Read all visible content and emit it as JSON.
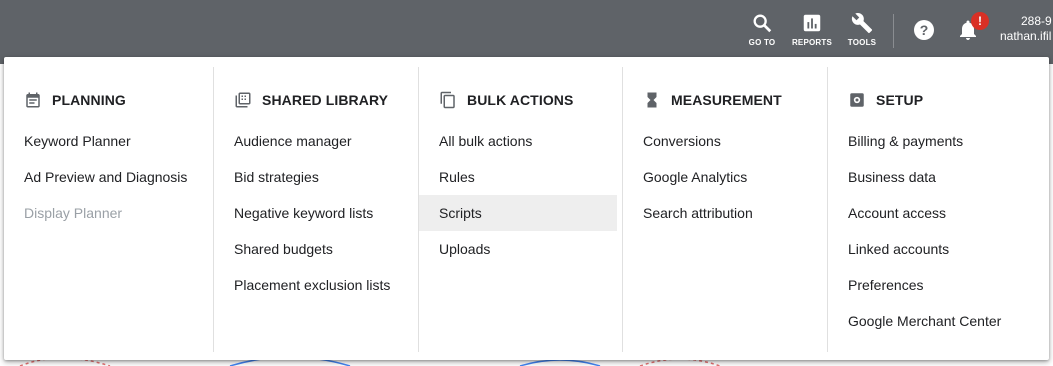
{
  "topbar": {
    "goto_label": "GO TO",
    "reports_label": "REPORTS",
    "tools_label": "TOOLS",
    "notification_badge": "!",
    "account_id": "288-9",
    "account_email": "nathan.ifil"
  },
  "menu": {
    "columns": [
      {
        "heading": "PLANNING",
        "icon": "calendar-icon",
        "items": [
          {
            "label": "Keyword Planner"
          },
          {
            "label": "Ad Preview and Diagnosis"
          },
          {
            "label": "Display Planner",
            "disabled": true
          }
        ]
      },
      {
        "heading": "SHARED LIBRARY",
        "icon": "library-icon",
        "items": [
          {
            "label": "Audience manager"
          },
          {
            "label": "Bid strategies"
          },
          {
            "label": "Negative keyword lists"
          },
          {
            "label": "Shared budgets"
          },
          {
            "label": "Placement exclusion lists"
          }
        ]
      },
      {
        "heading": "BULK ACTIONS",
        "icon": "copy-icon",
        "items": [
          {
            "label": "All bulk actions"
          },
          {
            "label": "Rules"
          },
          {
            "label": "Scripts",
            "selected": true
          },
          {
            "label": "Uploads"
          }
        ]
      },
      {
        "heading": "MEASUREMENT",
        "icon": "hourglass-icon",
        "items": [
          {
            "label": "Conversions"
          },
          {
            "label": "Google Analytics"
          },
          {
            "label": "Search attribution"
          }
        ]
      },
      {
        "heading": "SETUP",
        "icon": "settings-icon",
        "items": [
          {
            "label": "Billing & payments"
          },
          {
            "label": "Business data"
          },
          {
            "label": "Account access"
          },
          {
            "label": "Linked accounts"
          },
          {
            "label": "Preferences"
          },
          {
            "label": "Google Merchant Center"
          }
        ]
      }
    ]
  }
}
